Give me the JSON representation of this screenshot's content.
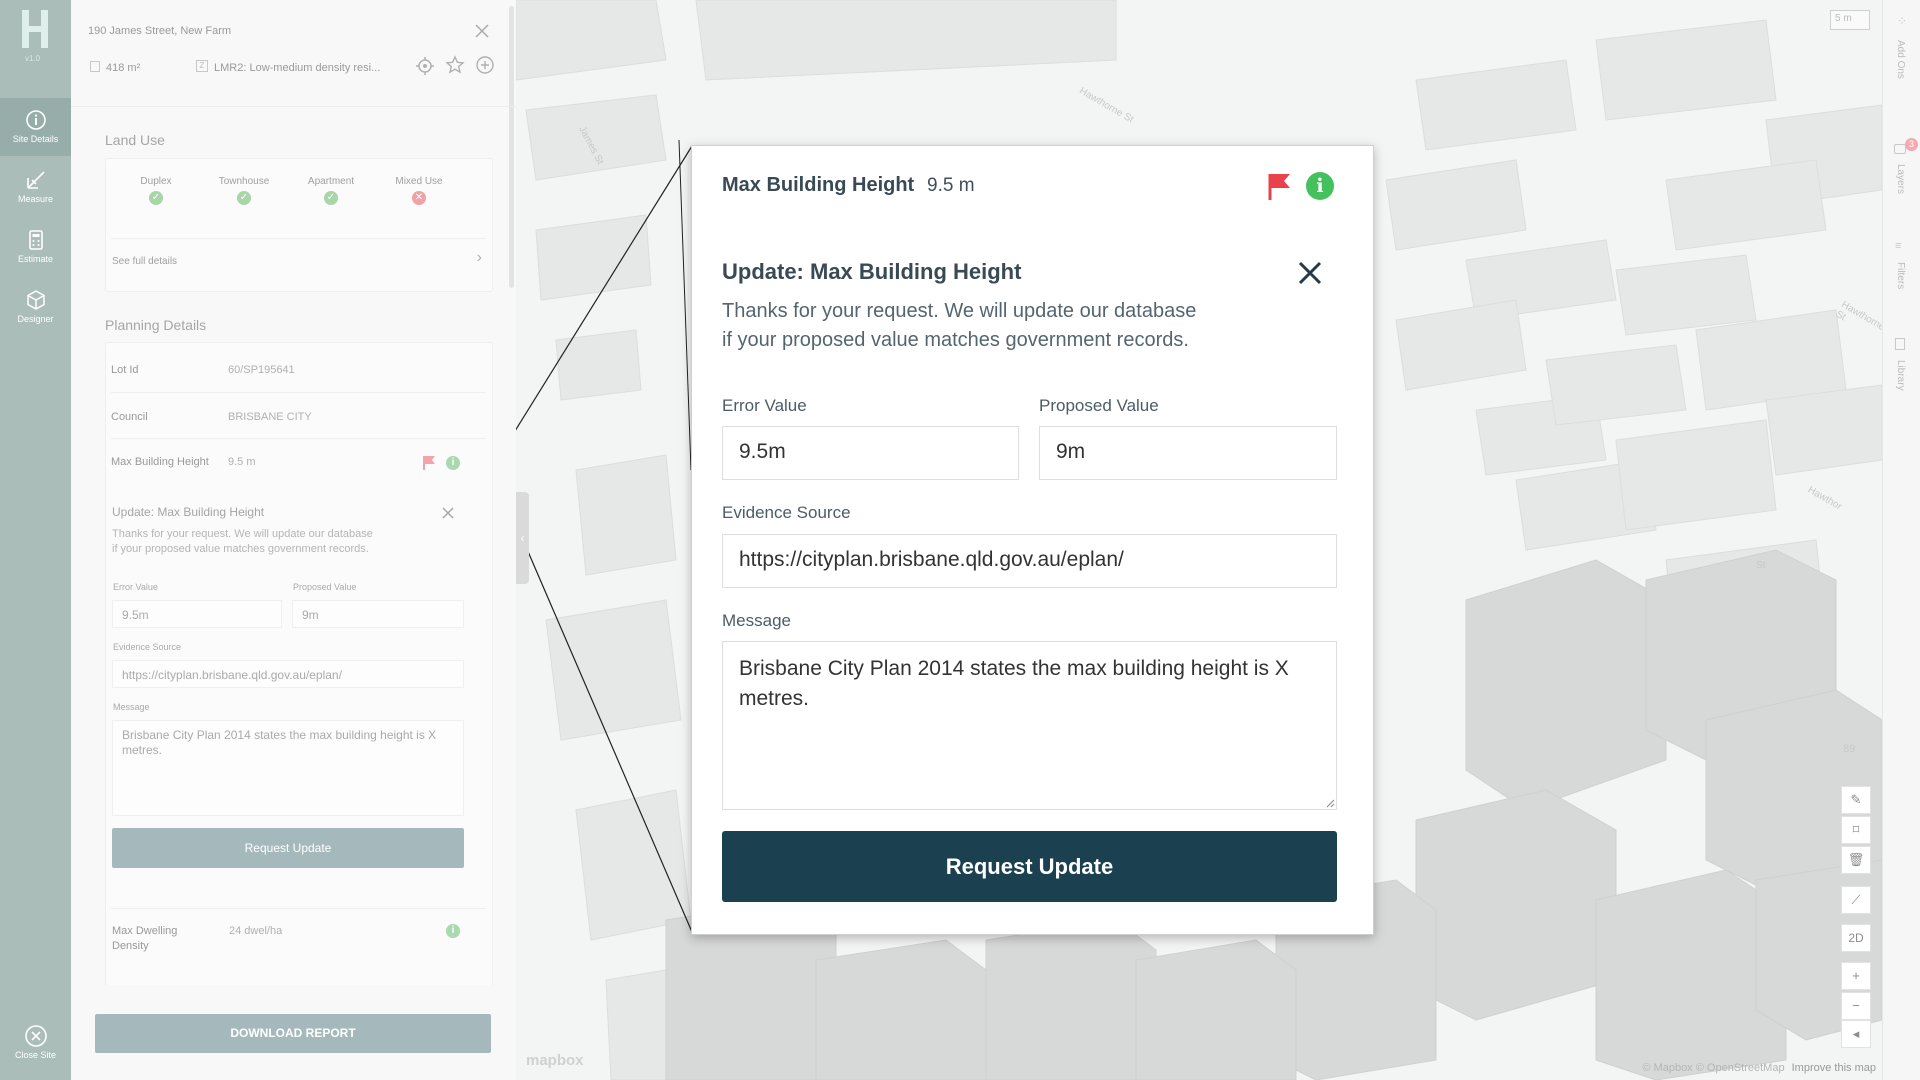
{
  "rail": {
    "version": "v1.0",
    "items": [
      {
        "label": "Site Details",
        "icon": "info-icon"
      },
      {
        "label": "Measure",
        "icon": "measure-icon"
      },
      {
        "label": "Estimate",
        "icon": "calculator-icon"
      },
      {
        "label": "Designer",
        "icon": "cube-icon"
      }
    ],
    "close_label": "Close Site"
  },
  "site": {
    "address": "190 James Street, New Farm",
    "area": "418 m²",
    "zone": "LMR2: Low-medium density resi..."
  },
  "land_use": {
    "title": "Land Use",
    "items": [
      {
        "label": "Duplex",
        "allowed": true
      },
      {
        "label": "Townhouse",
        "allowed": true
      },
      {
        "label": "Apartment",
        "allowed": true
      },
      {
        "label": "Mixed Use",
        "allowed": false
      }
    ],
    "see_full": "See full details"
  },
  "planning": {
    "title": "Planning Details",
    "lot_id_label": "Lot Id",
    "lot_id": "60/SP195641",
    "council_label": "Council",
    "council": "BRISBANE CITY",
    "mbh_label": "Max Building Height",
    "mbh": "9.5 m",
    "density_label_1": "Max Dwelling",
    "density_label_2": "Density",
    "density": "24 dwel/ha"
  },
  "form": {
    "title": "Update: Max Building Height",
    "thanks_1": "Thanks for your request. We will update our database",
    "thanks_2": "if your proposed value matches government records.",
    "error_label": "Error Value",
    "error_value": "9.5m",
    "proposed_label": "Proposed Value",
    "proposed_value": "9m",
    "evidence_label": "Evidence Source",
    "evidence_value": "https://cityplan.brisbane.qld.gov.au/eplan/",
    "message_label": "Message",
    "message_value": "Brisbane City Plan 2014 states the max building height is X metres.",
    "submit": "Request Update"
  },
  "dialog": {
    "header_title": "Max Building Height",
    "header_value": "9.5 m"
  },
  "download": "DOWNLOAD REPORT",
  "map": {
    "right_tabs": [
      "Add Ons",
      "Layers",
      "Filters",
      "Library"
    ],
    "layers_badge": "3",
    "scale": "5 m",
    "view_toggle": "2D",
    "attribution": "© Mapbox © OpenStreetMap",
    "improve": "Improve this map",
    "logo": "mapbox",
    "street_labels": [
      "James St",
      "Hawthorne St",
      "Hawthorne St",
      "Hawthor",
      "St"
    ],
    "building_number": "89"
  },
  "colors": {
    "rail": "#aabdb9",
    "primary_button": "#1b4151",
    "flag": "#e8424b",
    "info": "#44c15d"
  }
}
